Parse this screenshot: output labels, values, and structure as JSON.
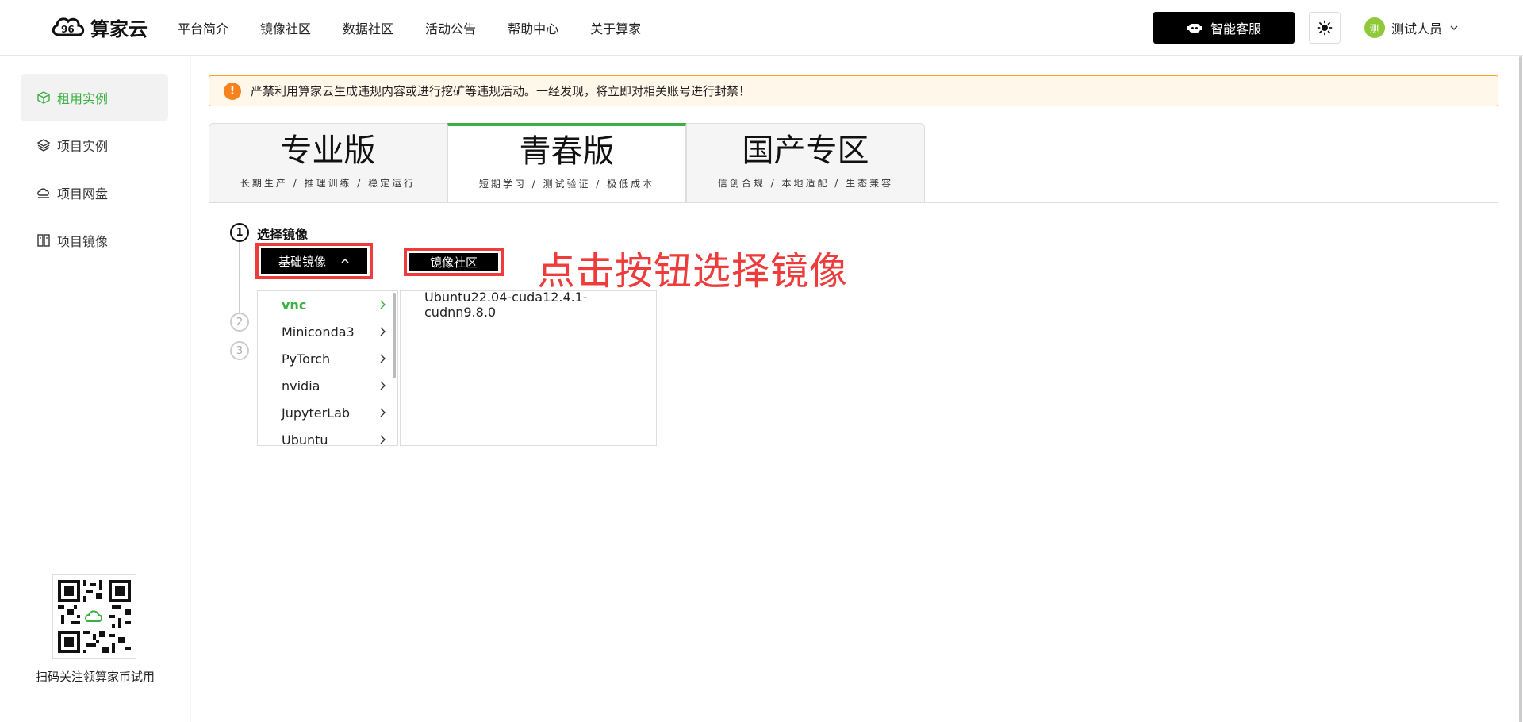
{
  "brand": {
    "name": "算家云"
  },
  "nav": [
    "平台简介",
    "镜像社区",
    "数据社区",
    "活动公告",
    "帮助中心",
    "关于算家"
  ],
  "header": {
    "service_label": "智能客服",
    "user_name": "测试人员",
    "avatar_char": "测"
  },
  "sidebar": {
    "items": [
      {
        "label": "租用实例",
        "icon": "cube-icon",
        "active": true
      },
      {
        "label": "项目实例",
        "icon": "layers-icon"
      },
      {
        "label": "项目网盘",
        "icon": "cloud-drive-icon"
      },
      {
        "label": "项目镜像",
        "icon": "image-icon"
      }
    ],
    "qr_caption": "扫码关注领算家币试用"
  },
  "alert": {
    "icon": "!",
    "text": "严禁利用算家云生成违规内容或进行挖矿等违规活动。一经发现，将立即对相关账号进行封禁！"
  },
  "tabs": [
    {
      "title": "专业版",
      "subtitle": "长期生产 / 推理训练 / 稳定运行"
    },
    {
      "title": "青春版",
      "subtitle": "短期学习 / 测试验证 / 极低成本",
      "active": true
    },
    {
      "title": "国产专区",
      "subtitle": "信创合规 / 本地适配 / 生态兼容"
    }
  ],
  "steps": {
    "s1": "1",
    "s2": "2",
    "s3": "3",
    "s1_label": "选择镜像"
  },
  "buttons": {
    "base_image": "基础镜像",
    "community": "镜像社区"
  },
  "annotation": "点击按钮选择镜像",
  "cascader": {
    "level1": [
      "vnc",
      "Miniconda3",
      "PyTorch",
      "nvidia",
      "JupyterLab",
      "Ubuntu"
    ],
    "level2": [
      "Ubuntu22.04-cuda12.4.1-cudnn9.8.0"
    ]
  },
  "colors": {
    "accent": "#3cb043",
    "annotation": "#ee3b3b",
    "alert": "#f5821f"
  }
}
